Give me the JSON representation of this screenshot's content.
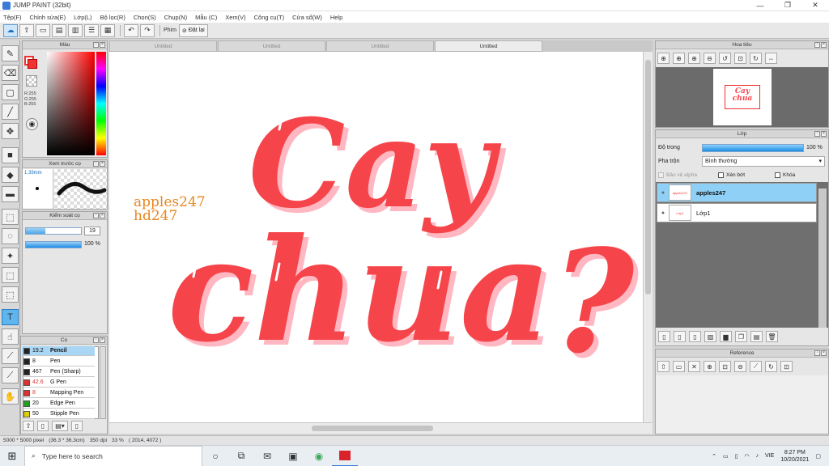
{
  "window": {
    "title": "JUMP PAINT (32bit)"
  },
  "menus": [
    "Tệp(F)",
    "Chỉnh sửa(E)",
    "Lớp(L)",
    "Bộ lọc(R)",
    "Chọn(S)",
    "Chụp(N)",
    "Mẫu (C)",
    "Xem(V)",
    "Công cụ(T)",
    "Cửa sổ(W)",
    "Help"
  ],
  "toolbar": {
    "phim_label": "Phim",
    "reset_label": "Đặt lại"
  },
  "panels": {
    "color_title": "Màu",
    "color_readout": {
      "r": "R:255",
      "g": "G:255",
      "b": "B:255"
    },
    "brush_preview_title": "Xem trước cọ",
    "brush_size": "1.39mm",
    "control_title": "Kiểm soát cọ",
    "control_size": "19",
    "control_opacity": "100 %",
    "brushes_title": "Cọ",
    "navigator_title": "Hoa tiêu",
    "layer_title": "Lớp",
    "reference_title": "Reference"
  },
  "layer_panel": {
    "opacity_label": "Độ trong",
    "opacity_value": "100 %",
    "opacity_fill": 1.0,
    "blend_label": "Pha trộn",
    "blend_value": "Bình thường",
    "protect_alpha": "Bảo vệ alpha",
    "clip": "Xén bớt",
    "lock": "Khóa"
  },
  "layers": [
    {
      "name": "apples247",
      "selected": true,
      "thumb": "apples247"
    },
    {
      "name": "Lớp1",
      "selected": false,
      "thumb": "Lớp1"
    }
  ],
  "brushes": [
    {
      "size": "19.2",
      "name": "Pencil",
      "color": "#222222",
      "selected": true
    },
    {
      "size": "8",
      "name": "Pen",
      "color": "#222222",
      "selected": false
    },
    {
      "size": "467",
      "name": "Pen (Sharp)",
      "color": "#222222",
      "selected": false
    },
    {
      "size": "42.6",
      "name": "G Pen",
      "color": "#e03030",
      "selected": false
    },
    {
      "size": "8",
      "name": "Mapping Pen",
      "color": "#e03030",
      "selected": false
    },
    {
      "size": "20",
      "name": "Edge Pen",
      "color": "#1fa01f",
      "selected": false
    },
    {
      "size": "50",
      "name": "Stipple Pen",
      "color": "#e0d000",
      "selected": false
    }
  ],
  "tabs": [
    {
      "label": "Untitled",
      "active": false
    },
    {
      "label": "Untitled",
      "active": false
    },
    {
      "label": "Untitled",
      "active": false
    },
    {
      "label": "Untitled",
      "active": true
    }
  ],
  "canvas": {
    "watermark_line1": "apples247",
    "watermark_line2": "hd247",
    "word1": "Cay",
    "word2": "chua",
    "punct": "?",
    "ink_color": "#f5444a",
    "shadow_color": "#ffb7c2"
  },
  "status": {
    "size": "5000 * 5000 pixel",
    "cm": "(36.3 * 36.3cm)",
    "dpi": "350 dpi",
    "zoom": "33 %",
    "coords": "( 2014, 4072 )"
  },
  "taskbar": {
    "search_placeholder": "Type here to search",
    "lang": "VIE",
    "time": "8:27 PM",
    "date": "10/20/2021"
  }
}
